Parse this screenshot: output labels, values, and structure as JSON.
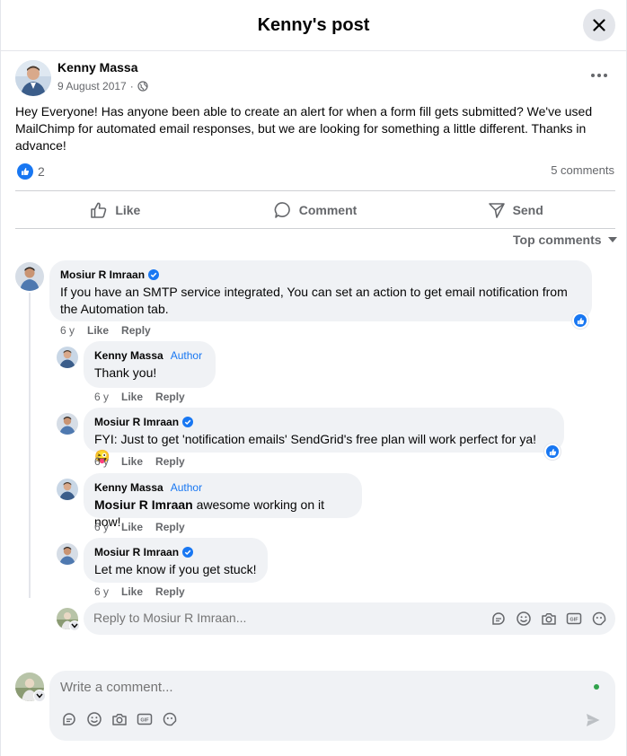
{
  "header": {
    "title": "Kenny's post"
  },
  "post": {
    "author": "Kenny Massa",
    "date": "9 August 2017",
    "separator": "·",
    "text": "Hey Everyone! Has anyone been able to create an alert for when a form fill gets submitted? We've used MailChimp for automated email responses, but we are looking for something a little different. Thanks in advance!",
    "reaction_count": "2",
    "comments_count": "5 comments"
  },
  "actions": {
    "like": "Like",
    "comment": "Comment",
    "send": "Send"
  },
  "sort": {
    "label": "Top comments"
  },
  "comments": [
    {
      "name": "Mosiur R Imraan",
      "verified": true,
      "text": "If you have an SMTP service integrated, You can set an action to get email notification from the Automation tab.",
      "age": "6 y",
      "like": "Like",
      "reply": "Reply"
    },
    {
      "name": "Kenny Massa",
      "author_tag": "Author",
      "text": "Thank you!",
      "age": "6 y",
      "like": "Like",
      "reply": "Reply"
    },
    {
      "name": "Mosiur R Imraan",
      "verified": true,
      "text": "FYI: Just to get 'notification emails' SendGrid's free plan will work perfect for ya!",
      "emoji": "😜",
      "age": "6 y",
      "like": "Like",
      "reply": "Reply"
    },
    {
      "name": "Kenny Massa",
      "author_tag": "Author",
      "mention": "Mosiur R Imraan",
      "text": " awesome working on it now!",
      "age": "6 y",
      "like": "Like",
      "reply": "Reply"
    },
    {
      "name": "Mosiur R Imraan",
      "verified": true,
      "text": "Let me know if you get stuck!",
      "age": "6 y",
      "like": "Like",
      "reply": "Reply"
    }
  ],
  "reply_box": {
    "placeholder": "Reply to Mosiur R Imraan..."
  },
  "composer": {
    "placeholder": "Write a comment..."
  },
  "icons": {
    "close": "close-icon",
    "globe": "globe-icon",
    "like": "thumbs-up-icon",
    "comment": "speech-bubble-icon",
    "send": "paper-plane-icon",
    "sticker": "sticker-icon",
    "emoji": "smiley-icon",
    "camera": "camera-icon",
    "gif": "gif-icon",
    "avatar-sticker": "avatar-sticker-icon",
    "verified": "verified-badge-icon"
  },
  "colors": {
    "accent": "#1877f2",
    "bubble": "#f0f2f5",
    "meta": "#65676b",
    "online": "#31a24c"
  }
}
